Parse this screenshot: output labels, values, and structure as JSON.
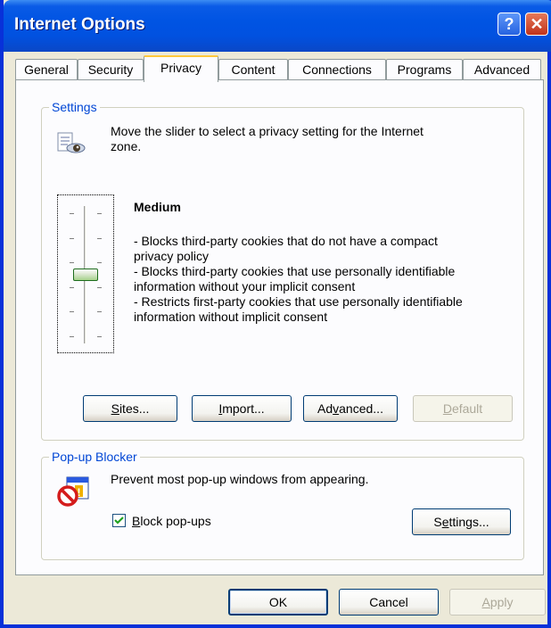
{
  "window": {
    "title": "Internet Options"
  },
  "tabs": [
    {
      "label": "General"
    },
    {
      "label": "Security"
    },
    {
      "label": "Privacy"
    },
    {
      "label": "Content"
    },
    {
      "label": "Connections"
    },
    {
      "label": "Programs"
    },
    {
      "label": "Advanced"
    }
  ],
  "active_tab": "Privacy",
  "settings": {
    "legend": "Settings",
    "instruction_line1": "Move the slider to select a privacy setting for the Internet",
    "instruction_line2": "zone.",
    "level_title": "Medium",
    "level_position": 0.5,
    "description_lines": [
      "- Blocks third-party cookies that do not have a compact",
      "privacy policy",
      "- Blocks third-party cookies that use personally identifiable",
      "information without your implicit consent",
      "- Restricts first-party cookies that use personally identifiable",
      "information without implicit consent"
    ],
    "buttons": {
      "sites_u": "S",
      "sites_rest": "ites...",
      "import_u": "I",
      "import_rest": "mport...",
      "advanced_pre": "Ad",
      "advanced_u": "v",
      "advanced_rest": "anced...",
      "default_u": "D",
      "default_rest": "efault"
    }
  },
  "popup": {
    "legend": "Pop-up Blocker",
    "description": "Prevent most pop-up windows from appearing.",
    "checkbox_u": "B",
    "checkbox_rest": "lock pop-ups",
    "checkbox_checked": true,
    "settings_pre": "S",
    "settings_u": "e",
    "settings_rest": "ttings..."
  },
  "footer": {
    "ok": "OK",
    "cancel": "Cancel",
    "apply_u": "A",
    "apply_rest": "pply"
  }
}
